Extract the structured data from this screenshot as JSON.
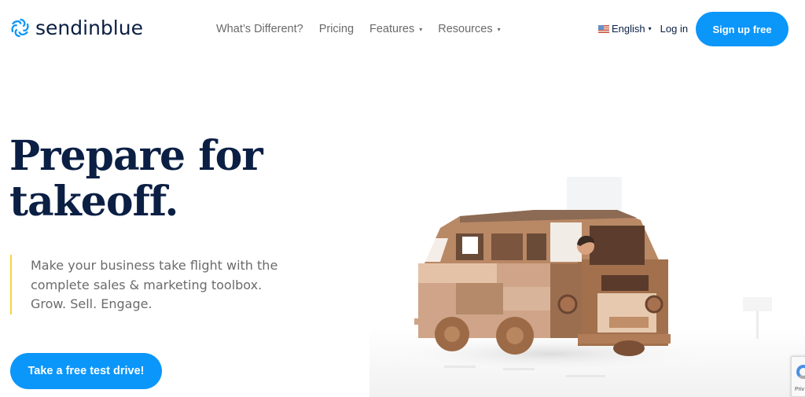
{
  "header": {
    "logo_text": "sendinblue",
    "nav": [
      {
        "label": "What’s Different?",
        "has_dropdown": false
      },
      {
        "label": "Pricing",
        "has_dropdown": false
      },
      {
        "label": "Features",
        "has_dropdown": true
      },
      {
        "label": "Resources",
        "has_dropdown": true
      }
    ],
    "language": "English",
    "login_label": "Log in",
    "signup_label": "Sign up free"
  },
  "hero": {
    "title_line1": "Prepare for",
    "title_line2": "takeoff.",
    "subtitle_lines": [
      "Make your business take flight with the",
      "complete sales & marketing toolbox.",
      "Grow. Sell. Engage."
    ],
    "cta_label": "Take a free test drive!",
    "illustration_alt": "wooden toy van with driver"
  },
  "recaptcha": {
    "text": "Priv"
  },
  "colors": {
    "brand_blue": "#0b96fa",
    "navy": "#0b1f44",
    "accent_yellow": "#f5d43b",
    "body_gray": "#6b6b6b"
  },
  "icons": {
    "caret": "▾"
  }
}
